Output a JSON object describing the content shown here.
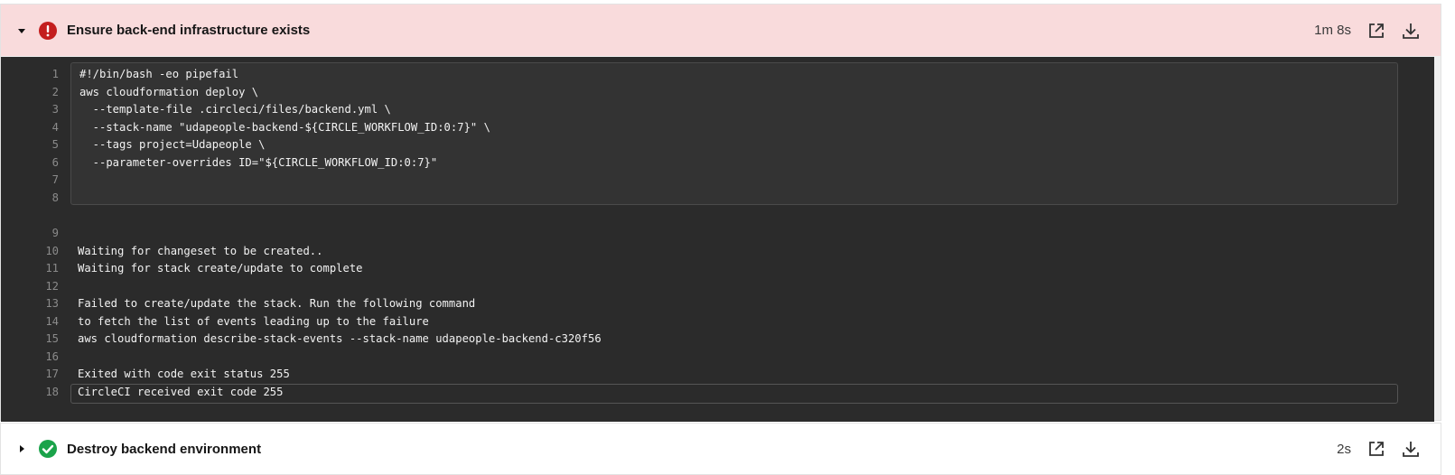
{
  "steps": [
    {
      "title": "Ensure back-end infrastructure exists",
      "duration": "1m 8s",
      "status": "failed",
      "status_color": "#c41e1e",
      "expanded": true,
      "icons": [
        "caret-down-icon",
        "error-icon",
        "open-external-icon",
        "download-icon"
      ]
    },
    {
      "title": "Destroy backend environment",
      "duration": "2s",
      "status": "success",
      "status_color": "#1aa34a",
      "expanded": false,
      "icons": [
        "caret-right-icon",
        "success-check-icon",
        "open-external-icon",
        "download-icon"
      ]
    }
  ],
  "colors": {
    "failed_header_bg": "#f9dbdc",
    "console_bg": "#2b2b2b",
    "command_bg": "#333333"
  },
  "console": {
    "command_lines": [
      {
        "n": "1",
        "text": "#!/bin/bash -eo pipefail"
      },
      {
        "n": "2",
        "text": "aws cloudformation deploy \\"
      },
      {
        "n": "3",
        "text": "  --template-file .circleci/files/backend.yml \\"
      },
      {
        "n": "4",
        "text": "  --stack-name \"udapeople-backend-${CIRCLE_WORKFLOW_ID:0:7}\" \\"
      },
      {
        "n": "5",
        "text": "  --tags project=Udapeople \\"
      },
      {
        "n": "6",
        "text": "  --parameter-overrides ID=\"${CIRCLE_WORKFLOW_ID:0:7}\""
      },
      {
        "n": "7",
        "text": ""
      },
      {
        "n": "8",
        "text": ""
      }
    ],
    "output_lines": [
      {
        "n": "9",
        "text": ""
      },
      {
        "n": "10",
        "text": "Waiting for changeset to be created.."
      },
      {
        "n": "11",
        "text": "Waiting for stack create/update to complete"
      },
      {
        "n": "12",
        "text": ""
      },
      {
        "n": "13",
        "text": "Failed to create/update the stack. Run the following command"
      },
      {
        "n": "14",
        "text": "to fetch the list of events leading up to the failure"
      },
      {
        "n": "15",
        "text": "aws cloudformation describe-stack-events --stack-name udapeople-backend-c320f56"
      },
      {
        "n": "16",
        "text": ""
      },
      {
        "n": "17",
        "text": "Exited with code exit status 255"
      },
      {
        "n": "18",
        "text": "CircleCI received exit code 255"
      }
    ]
  }
}
